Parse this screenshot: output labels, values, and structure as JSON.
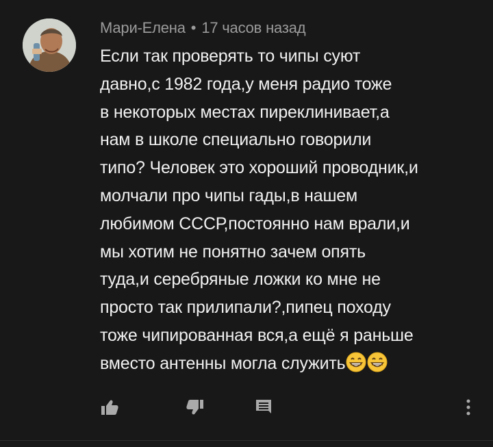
{
  "comment": {
    "author": "Мари-Елена",
    "separator": "•",
    "time": "17 часов назад",
    "lines": [
      "Если так проверять то чипы суют",
      "давно,с 1982 года,у меня радио тоже",
      "в некоторых местах пиреклинивает,а",
      "нам в школе специально говорили",
      "типо? Человек это хороший проводник,и",
      "молчали про чипы гады,в нашем",
      "любимом СССР,постоянно нам врали,и",
      "мы хотим не понятно зачем опять",
      "туда,и серебряные ложки ко мне не",
      "просто так прилипали?,пипец походу",
      "тоже чипированная вся,а ещё я раньше",
      "вместо антенны могла служить"
    ],
    "trailing_emoji": [
      "grinning-face-emoji",
      "grinning-face-emoji"
    ]
  },
  "actions": {
    "like_icon": "thumbs-up-icon",
    "dislike_icon": "thumbs-down-icon",
    "reply_icon": "comment-icon",
    "more_icon": "more-vertical-icon"
  },
  "colors": {
    "background": "#181818",
    "text": "#f1f1f1",
    "meta": "#9b9b9b",
    "icon": "#aaaaaa",
    "emoji": "#f7c537"
  }
}
